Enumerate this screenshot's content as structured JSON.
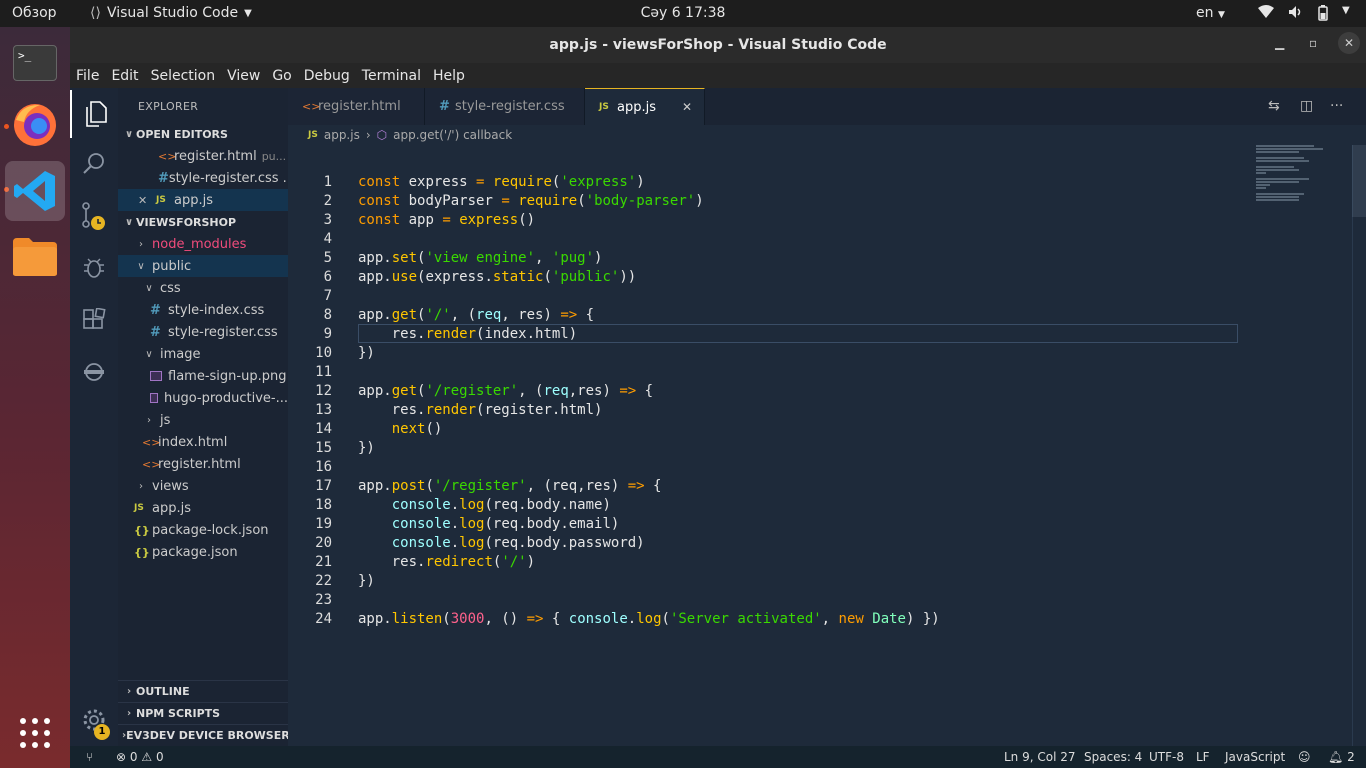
{
  "topbar": {
    "overview": "Обзор",
    "app_name": "Visual Studio Code",
    "clock": "Сәу 6  17:38",
    "lang": "en"
  },
  "window": {
    "title": "app.js - viewsForShop - Visual Studio Code"
  },
  "menu": [
    "File",
    "Edit",
    "Selection",
    "View",
    "Go",
    "Debug",
    "Terminal",
    "Help"
  ],
  "sidebar": {
    "title": "EXPLORER",
    "open_editors_label": "OPEN EDITORS",
    "open_editors": [
      {
        "name": "register.html",
        "hint": "pu..."
      },
      {
        "name": "style-register.css ..."
      },
      {
        "name": "app.js"
      }
    ],
    "project_label": "VIEWSFORSHOP",
    "tree": [
      {
        "name": "node_modules"
      },
      {
        "name": "public"
      },
      {
        "name": "css"
      },
      {
        "name": "style-index.css"
      },
      {
        "name": "style-register.css"
      },
      {
        "name": "image"
      },
      {
        "name": "flame-sign-up.png"
      },
      {
        "name": "hugo-productive-..."
      },
      {
        "name": "js"
      },
      {
        "name": "index.html"
      },
      {
        "name": "register.html"
      },
      {
        "name": "views"
      },
      {
        "name": "app.js"
      },
      {
        "name": "package-lock.json"
      },
      {
        "name": "package.json"
      }
    ],
    "bottom_panels": [
      "OUTLINE",
      "NPM SCRIPTS",
      "EV3DEV DEVICE BROWSER"
    ],
    "js_badge": "JS",
    "json_badge": "{}"
  },
  "tabs": [
    {
      "label": "register.html"
    },
    {
      "label": "style-register.css"
    },
    {
      "label": "app.js"
    }
  ],
  "breadcrumb": {
    "file": "app.js",
    "symbol": "app.get('/') callback"
  },
  "editor": {
    "line_numbers": [
      "1",
      "2",
      "3",
      "4",
      "5",
      "6",
      "7",
      "8",
      "9",
      "10",
      "11",
      "12",
      "13",
      "14",
      "15",
      "16",
      "17",
      "18",
      "19",
      "20",
      "21",
      "22",
      "23",
      "24"
    ],
    "current_line": 9
  },
  "status": {
    "errors": "0",
    "warnings": "0",
    "position": "Ln 9, Col 27",
    "spaces": "Spaces: 4",
    "encoding": "UTF-8",
    "eol": "LF",
    "language": "JavaScript",
    "notifications": "2",
    "settings_badge": "1"
  },
  "colors": {
    "editor_bg": "#1e2a3a",
    "keyword": "#ff9d00",
    "string": "#3ad900",
    "function": "#ffc600"
  }
}
